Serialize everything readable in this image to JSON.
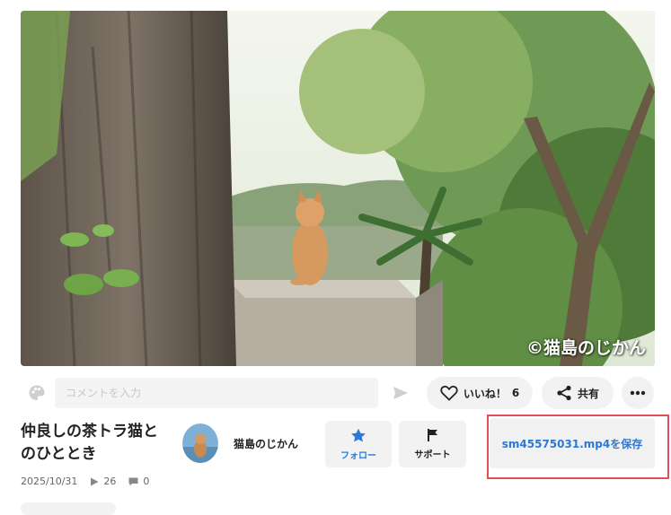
{
  "video": {
    "watermark": "©猫島のじかん"
  },
  "comment": {
    "placeholder": "コメントを入力",
    "palette_icon": "palette-icon",
    "send_icon": "send-icon"
  },
  "actions": {
    "like_label": "いいね！",
    "like_count": "6",
    "share_label": "共有",
    "more_icon": "more-icon"
  },
  "video_info": {
    "title": "仲良しの茶トラ猫とのひととき",
    "date": "2025/10/31",
    "views": "26",
    "comments": "0"
  },
  "channel": {
    "name": "猫島のじかん"
  },
  "buttons": {
    "follow": "フォロー",
    "support": "サポート",
    "save": "sm45575031.mp4を保存"
  },
  "colors": {
    "accent": "#2b79d6",
    "highlight_border": "#e24e57"
  }
}
